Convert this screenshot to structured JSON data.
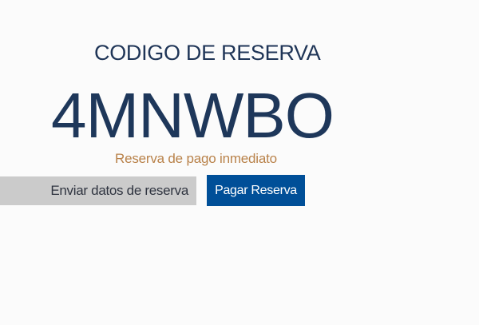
{
  "reservation": {
    "heading": "CODIGO DE RESERVA",
    "code": "4MNWBO",
    "note": "Reserva de pago inmediato"
  },
  "actions": {
    "send_label": "Enviar datos de reserva",
    "pay_label": "Pagar Reserva"
  },
  "colors": {
    "heading": "#1f3557",
    "code": "#1e375a",
    "note": "#b9824a",
    "send_button_bg": "#cbcbcb",
    "pay_button_bg": "#004f98"
  }
}
